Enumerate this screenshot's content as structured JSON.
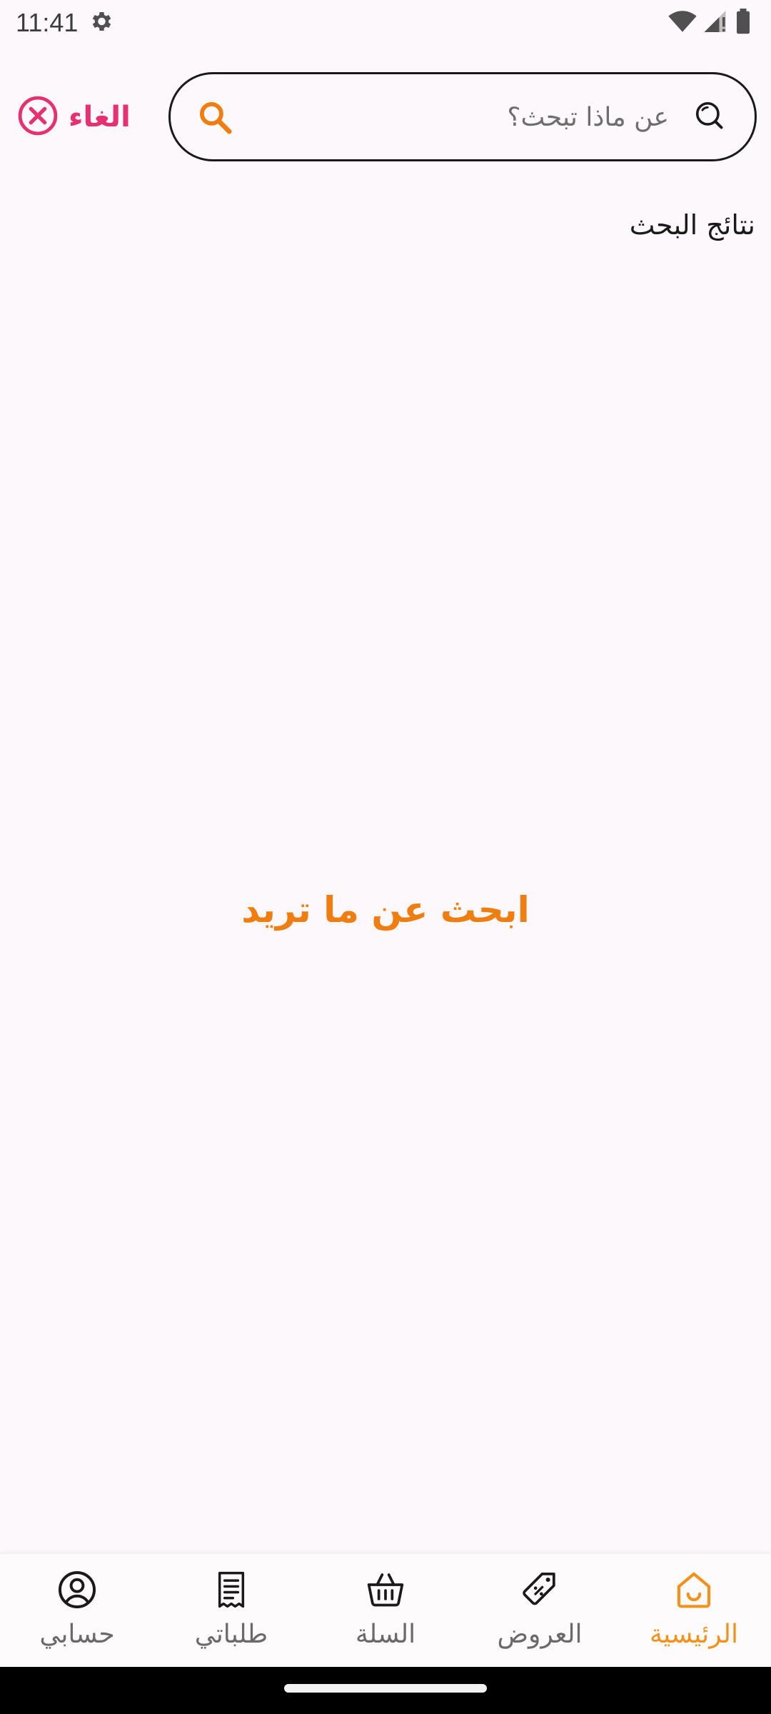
{
  "status_bar": {
    "time": "11:41",
    "icons": [
      "gear-icon",
      "wifi-icon",
      "signal-icon",
      "battery-icon"
    ]
  },
  "search": {
    "placeholder": "عن ماذا تبحث؟",
    "value": ""
  },
  "cancel": {
    "label": "الغاء"
  },
  "results": {
    "heading": "نتائج البحث",
    "empty_message": "ابحث عن ما تريد"
  },
  "bottom_nav": {
    "items": [
      {
        "label": "الرئيسية",
        "icon": "home-icon",
        "active": true
      },
      {
        "label": "العروض",
        "icon": "offers-tag-icon",
        "active": false
      },
      {
        "label": "السلة",
        "icon": "basket-icon",
        "active": false
      },
      {
        "label": "طلباتي",
        "icon": "receipt-icon",
        "active": false
      },
      {
        "label": "حسابي",
        "icon": "account-icon",
        "active": false
      }
    ]
  },
  "colors": {
    "accent_orange": "#f07d10",
    "cancel_pink": "#e6306f",
    "background": "#fdf8fb",
    "nav_inactive": "#6a6a6a"
  }
}
